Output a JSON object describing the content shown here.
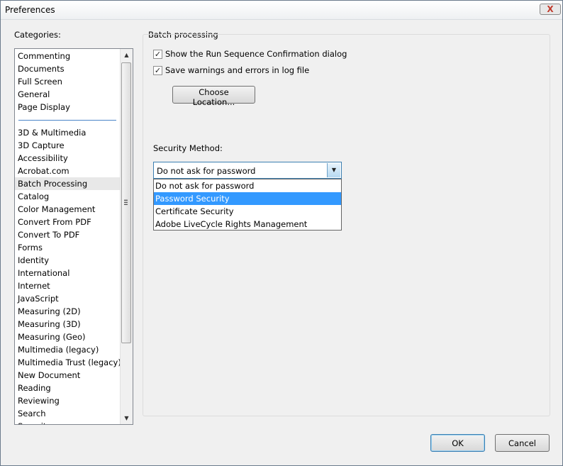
{
  "window": {
    "title": "Preferences",
    "close_label": "X"
  },
  "categories": {
    "label": "Categories:",
    "top_items": [
      "Commenting",
      "Documents",
      "Full Screen",
      "General",
      "Page Display"
    ],
    "items": [
      "3D & Multimedia",
      "3D Capture",
      "Accessibility",
      "Acrobat.com",
      "Batch Processing",
      "Catalog",
      "Color Management",
      "Convert From PDF",
      "Convert To PDF",
      "Forms",
      "Identity",
      "International",
      "Internet",
      "JavaScript",
      "Measuring (2D)",
      "Measuring (3D)",
      "Measuring (Geo)",
      "Multimedia (legacy)",
      "Multimedia Trust (legacy)",
      "New Document",
      "Reading",
      "Reviewing",
      "Search",
      "Security"
    ],
    "selected": "Batch Processing"
  },
  "batch": {
    "group_title": "Batch processing",
    "show_confirm_label": "Show the Run Sequence Confirmation dialog",
    "show_confirm_checked": true,
    "save_warnings_label": "Save warnings and errors in log file",
    "save_warnings_checked": true,
    "choose_location_label": "Choose Location...",
    "security_method_label": "Security Method:",
    "security_method_value": "Do not ask for password",
    "security_options": [
      "Do not ask for password",
      "Password Security",
      "Certificate Security",
      "Adobe LiveCycle Rights Management"
    ],
    "highlighted_option": "Password Security"
  },
  "footer": {
    "ok_label": "OK",
    "cancel_label": "Cancel"
  },
  "icons": {
    "check": "check-icon",
    "scroll_up": "scroll-up-arrow-icon",
    "scroll_down": "scroll-down-arrow-icon",
    "dropdown": "dropdown-arrow-icon"
  },
  "colors": {
    "selection": "#3399ff",
    "list_selected": "#e8e8e8",
    "separator": "#4a84c8"
  }
}
